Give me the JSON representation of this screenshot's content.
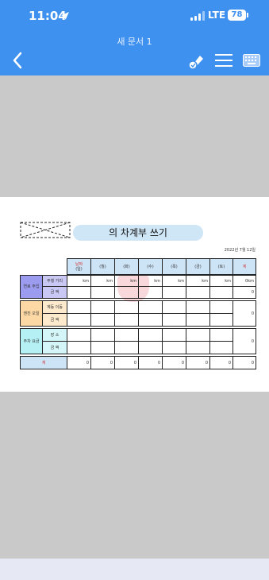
{
  "status": {
    "time": "11:04",
    "network": "LTE",
    "battery": "78"
  },
  "toolbar": {
    "title": "새 문서 1"
  },
  "icons": {
    "back": "chevron-left-icon",
    "pen": "pen-mode-icon",
    "menu": "menu-icon",
    "keyboard": "keyboard-icon"
  },
  "document": {
    "title": "의 차계부 쓰기",
    "date": "2022년 7월 12일",
    "header": {
      "date_label": "날짜",
      "days": [
        "(일)",
        "(월)",
        "(화)",
        "(수)",
        "(목)",
        "(금)",
        "(토)"
      ],
      "total": "계"
    },
    "fuel": {
      "label": "연료 주입",
      "distance_label": "주행 거리",
      "amount_label": "금 액",
      "unit": "km",
      "distance_total": "0km",
      "amount_total": "0"
    },
    "engine": {
      "label": "엔진 오일",
      "change_label": "계동 이동",
      "amount_label": "금 액",
      "total": "0"
    },
    "parking": {
      "label": "주차 요금",
      "place_label": "장 소",
      "amount_label": "금 액",
      "total": "0"
    },
    "sum": {
      "label": "계",
      "values": [
        "0",
        "0",
        "0",
        "0",
        "0",
        "0",
        "0",
        "0"
      ]
    }
  },
  "colors": {
    "accent": "#3f91ef",
    "header_cell": "#cde3f6",
    "fuel": "#9b9cf0",
    "engine": "#fcd9a4",
    "parking": "#b4f0f4"
  }
}
